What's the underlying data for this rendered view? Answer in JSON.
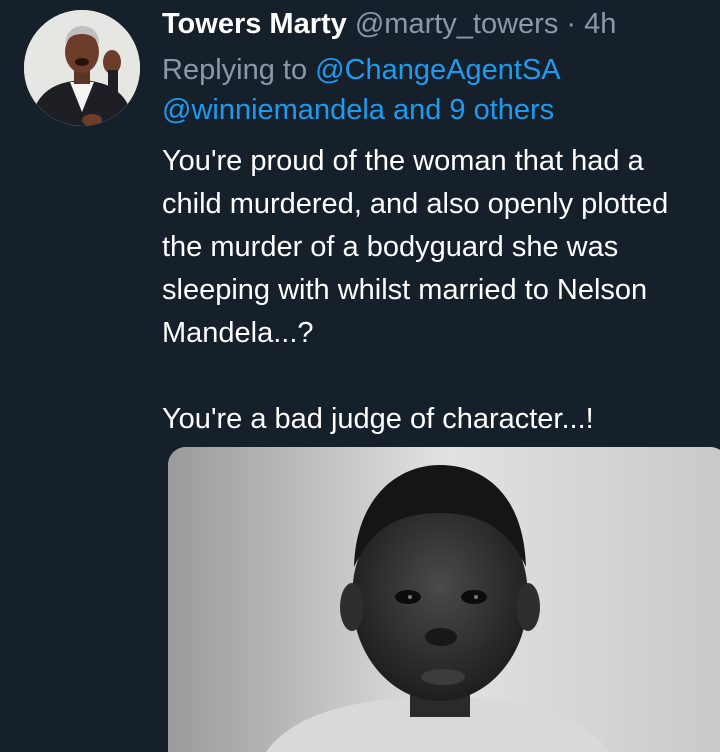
{
  "tweet": {
    "display_name": "Towers Marty",
    "handle": "@marty_towers",
    "separator": "·",
    "time": "4h",
    "replying_prefix": "Replying to",
    "replying_to_primary": "@ChangeAgentSA",
    "replying_to_secondary": "@winniemandela and 9 others",
    "body_lines": [
      "You're proud of the woman that had a",
      "child murdered, and also openly plotted",
      "the murder of a bodyguard she was",
      "sleeping with whilst married to Nelson",
      "Mandela...?"
    ],
    "body_closing": "You're a bad judge of character...!"
  },
  "colors": {
    "background": "#15202b",
    "text_primary": "#ffffff",
    "text_secondary": "#8b98a5",
    "link": "#1d9bf0"
  }
}
